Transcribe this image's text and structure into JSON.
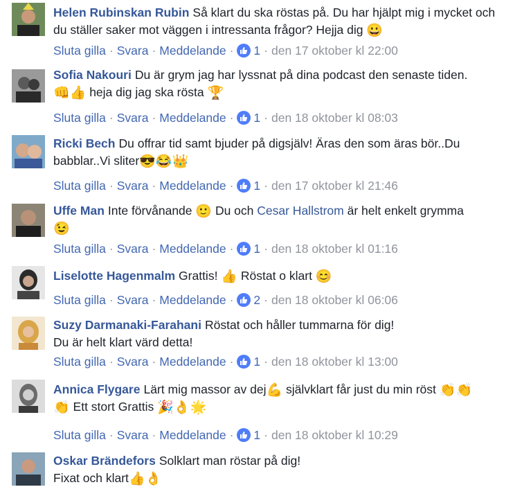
{
  "colors": {
    "author": "#365899",
    "action": "#4267b2",
    "meta": "#90949c",
    "text": "#1d2129",
    "like": "#4f7dfa"
  },
  "comments": [
    {
      "author": "Helen Rubinskan Rubin",
      "text": "Så klart du ska röstas på. Du har hjälpt mig i mycket och du ställer saker mot väggen i intressanta frågor? Hejja dig",
      "emoji": "😀",
      "actions": {
        "unlike": "Sluta gilla",
        "reply": "Svara",
        "message": "Meddelande"
      },
      "likes": "1",
      "timestamp": "den 17 oktober kl 22:00"
    },
    {
      "author": "Sofia Nakouri",
      "text": "Du är grym jag har lyssnat på dina podcast den senaste tiden.",
      "emoji": "👊👍",
      "text2": "heja dig jag ska rösta",
      "emoji2": "🏆",
      "actions": {
        "unlike": "Sluta gilla",
        "reply": "Svara",
        "message": "Meddelande"
      },
      "likes": "1",
      "timestamp": "den 18 oktober kl 08:03"
    },
    {
      "author": "Ricki Bech",
      "text": "Du offrar tid samt bjuder på digsjälv! Äras den som äras bör..Du babblar..Vi sliter",
      "emoji": "😎😂👑",
      "actions": {
        "unlike": "Sluta gilla",
        "reply": "Svara",
        "message": "Meddelande"
      },
      "likes": "1",
      "timestamp": "den 17 oktober kl 21:46"
    },
    {
      "author": "Uffe Man",
      "text": "Inte förvånande",
      "emoji": "🙂",
      "text2": "Du och",
      "mention": "Cesar Hallstrom",
      "text3": "är helt enkelt grymma",
      "emoji2": "😉",
      "actions": {
        "unlike": "Sluta gilla",
        "reply": "Svara",
        "message": "Meddelande"
      },
      "likes": "1",
      "timestamp": "den 18 oktober kl 01:16"
    },
    {
      "author": "Liselotte Hagenmalm",
      "text": "Grattis!",
      "emoji": "👍",
      "text2": "Röstat o klart",
      "emoji2": "😊",
      "actions": {
        "unlike": "Sluta gilla",
        "reply": "Svara",
        "message": "Meddelande"
      },
      "likes": "2",
      "timestamp": "den 18 oktober kl 06:06"
    },
    {
      "author": "Suzy Darmanaki-Farahani",
      "text": "Röstat och håller tummarna för dig!",
      "text2": "Du är helt klart värd detta!",
      "actions": {
        "unlike": "Sluta gilla",
        "reply": "Svara",
        "message": "Meddelande"
      },
      "likes": "1",
      "timestamp": "den 18 oktober kl 13:00"
    },
    {
      "author": "Annica Flygare",
      "text": "Lärt mig massor av dej",
      "emoji": "💪",
      "text2": "självklart får just du min röst",
      "emoji2": "👏👏",
      "emoji3": "👏",
      "text3": "Ett stort Grattis",
      "emoji4": "🎉👌🌟",
      "actions": {
        "unlike": "Sluta gilla",
        "reply": "Svara",
        "message": "Meddelande"
      },
      "likes": "1",
      "timestamp": "den 18 oktober kl 10:29"
    },
    {
      "author": "Oskar Brändefors",
      "text": "Solklart man röstar på dig!",
      "text2": "Fixat och klart",
      "emoji": "👍👌"
    }
  ]
}
